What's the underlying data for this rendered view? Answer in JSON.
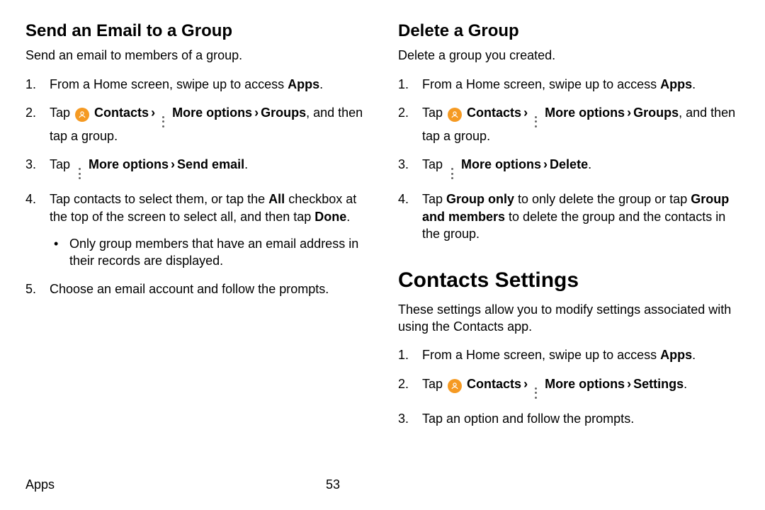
{
  "footer": {
    "section": "Apps",
    "page": "53"
  },
  "left": {
    "heading": "Send an Email to a Group",
    "intro": "Send an email to members of a group.",
    "step1_a": "From a Home screen, swipe up to access ",
    "step1_b": "Apps",
    "step1_c": ".",
    "step2_tap": "Tap ",
    "step2_contacts": "Contacts",
    "step2_more": "More options",
    "step2_groups": "Groups",
    "step2_tail": ", and then tap a group.",
    "step3_tap": "Tap ",
    "step3_more": "More options",
    "step3_send": "Send email",
    "step3_dot": ".",
    "step4_a": "Tap contacts to select them, or tap the ",
    "step4_all": "All",
    "step4_b": " checkbox at the top of the screen to select all, and then tap ",
    "step4_done": "Done",
    "step4_c": ".",
    "step4_bullet": "Only group members that have an email address in their records are displayed.",
    "step5": "Choose an email account and follow the prompts."
  },
  "right": {
    "heading": "Delete a Group",
    "intro": "Delete a group you created.",
    "step1_a": "From a Home screen, swipe up to access ",
    "step1_b": "Apps",
    "step1_c": ".",
    "step2_tap": "Tap ",
    "step2_contacts": "Contacts",
    "step2_more": "More options",
    "step2_groups": "Groups",
    "step2_tail": ", and then tap a group.",
    "step3_tap": "Tap ",
    "step3_more": "More options",
    "step3_delete": "Delete",
    "step3_dot": ".",
    "step4_a": "Tap ",
    "step4_go": "Group only",
    "step4_b": " to only delete the group or tap ",
    "step4_gm": "Group and members",
    "step4_c": " to delete the group and the contacts in the group.",
    "settings_heading": "Contacts Settings",
    "settings_intro": "These settings allow you to modify settings associated with using the Contacts app.",
    "s1_a": "From a Home screen, swipe up to access ",
    "s1_b": "Apps",
    "s1_c": ".",
    "s2_tap": "Tap ",
    "s2_contacts": "Contacts",
    "s2_more": "More options",
    "s2_settings": "Settings",
    "s2_dot": ".",
    "s3": "Tap an option and follow the prompts."
  }
}
